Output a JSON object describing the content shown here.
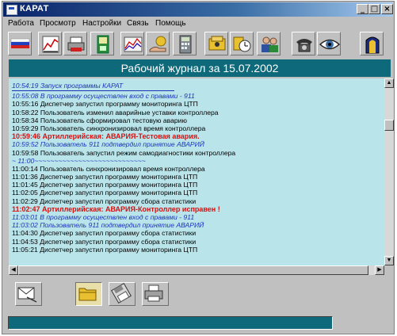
{
  "window": {
    "title": "КАРАТ",
    "minimize": "_",
    "maximize": "□",
    "close": "×"
  },
  "menu": [
    "Работа",
    "Просмотр",
    "Настройки",
    "Связь",
    "Помощь"
  ],
  "toolbar_icons": [
    "flag-icon",
    "chart-icon",
    "printer-icon",
    "device-icon",
    "line-chart-icon",
    "hand-coin-icon",
    "calculator-icon",
    "phone-book-icon",
    "clock-icon",
    "users-icon",
    "telephone-icon",
    "eye-icon",
    "exit-door-icon"
  ],
  "journal": {
    "header": "Рабочий журнал за 15.07.2002",
    "lines": [
      {
        "type": "info",
        "text": "10:54:19    Запуск программы КАРАТ"
      },
      {
        "type": "rule",
        "text": ""
      },
      {
        "type": "info",
        "text": "10:55:08  В программу осуществлен вход с правами - 911"
      },
      {
        "type": "normal",
        "text": "10:55:16  Диспетчер запустил программу мониторинга ЦТП"
      },
      {
        "type": "normal",
        "text": "10:58:22  Пользователь изменил аварийные уставки контроллера"
      },
      {
        "type": "normal",
        "text": "10:58:34  Пользователь сформировал тестовую аварию"
      },
      {
        "type": "normal",
        "text": "10:59:29  Пользователь синхронизировал время контроллера"
      },
      {
        "type": "alarm",
        "text": "10:59:46  Артиллерийская:   АВАРИЯ-Тестовая авария."
      },
      {
        "type": "info",
        "text": "10:59:52  Пользователь 911 подтвердил принятие АВАРИЙ"
      },
      {
        "type": "normal",
        "text": "10:59:58  Пользователь запустил режим самодиагностики контроллера"
      },
      {
        "type": "sep",
        "text": "~ 11:00~~~~~~~~~~~~~~~~~~~~~~~~~~~~"
      },
      {
        "type": "normal",
        "text": "11:00:14  Пользователь синхронизировал время контроллера"
      },
      {
        "type": "normal",
        "text": "11:01:36  Диспетчер запустил программу мониторинга ЦТП"
      },
      {
        "type": "normal",
        "text": "11:01:45  Диспетчер запустил программу мониторинга ЦТП"
      },
      {
        "type": "normal",
        "text": "11:02:05  Диспетчер запустил программу мониторинга ЦТП"
      },
      {
        "type": "normal",
        "text": "11:02:29  Диспетчер запустил программу сбора статистики"
      },
      {
        "type": "alarm",
        "text": "11:02:47  Артиллерийская:   АВАРИЯ-Контроллер исправен !"
      },
      {
        "type": "info",
        "text": "11:03:01  В программу осуществлен вход с правами - 911"
      },
      {
        "type": "info",
        "text": "11:03:02  Пользователь 911 подтвердил принятие АВАРИЙ"
      },
      {
        "type": "normal",
        "text": "11:04:30  Диспетчер запустил программу сбора статистики"
      },
      {
        "type": "normal",
        "text": "11:04:53  Диспетчер запустил программу сбора статистики"
      },
      {
        "type": "normal",
        "text": "11:05:21  Диспетчер запустил программу мониторинга ЦТП"
      }
    ]
  },
  "scroll": {
    "up": "▲",
    "down": "▼",
    "left": "◀",
    "right": "▶"
  },
  "colors": {
    "header_bg": "#0e6a7a",
    "log_bg": "#b9e4ea",
    "info_text": "#1a36b8",
    "alarm_text": "#d81010"
  }
}
